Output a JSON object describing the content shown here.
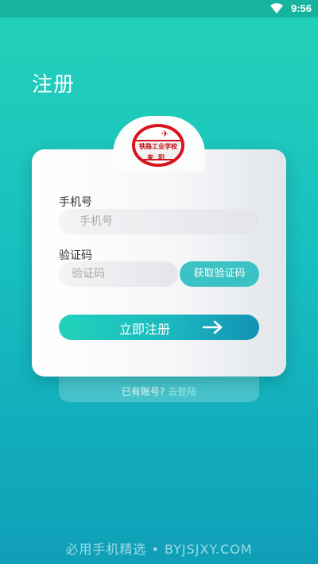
{
  "status_bar": {
    "time": "9:56",
    "wifi_icon": "wifi-icon"
  },
  "page": {
    "title": "注册"
  },
  "logo": {
    "text_top": "铁路工业学校",
    "text_bottom": "来阳"
  },
  "form": {
    "phone_label": "手机号",
    "phone_placeholder": "手机号",
    "code_label": "验证码",
    "code_placeholder": "验证码",
    "get_code_button": "获取验证码",
    "submit_button": "立即注册",
    "submit_icon": "arrow-right-icon"
  },
  "footer": {
    "has_account": "已有账号?",
    "login_link": "去登陆"
  },
  "watermark": "必用手机精选 • BYJSJXY.COM",
  "colors": {
    "accent": "#1fc9bd",
    "logo_red": "#d8131c"
  }
}
